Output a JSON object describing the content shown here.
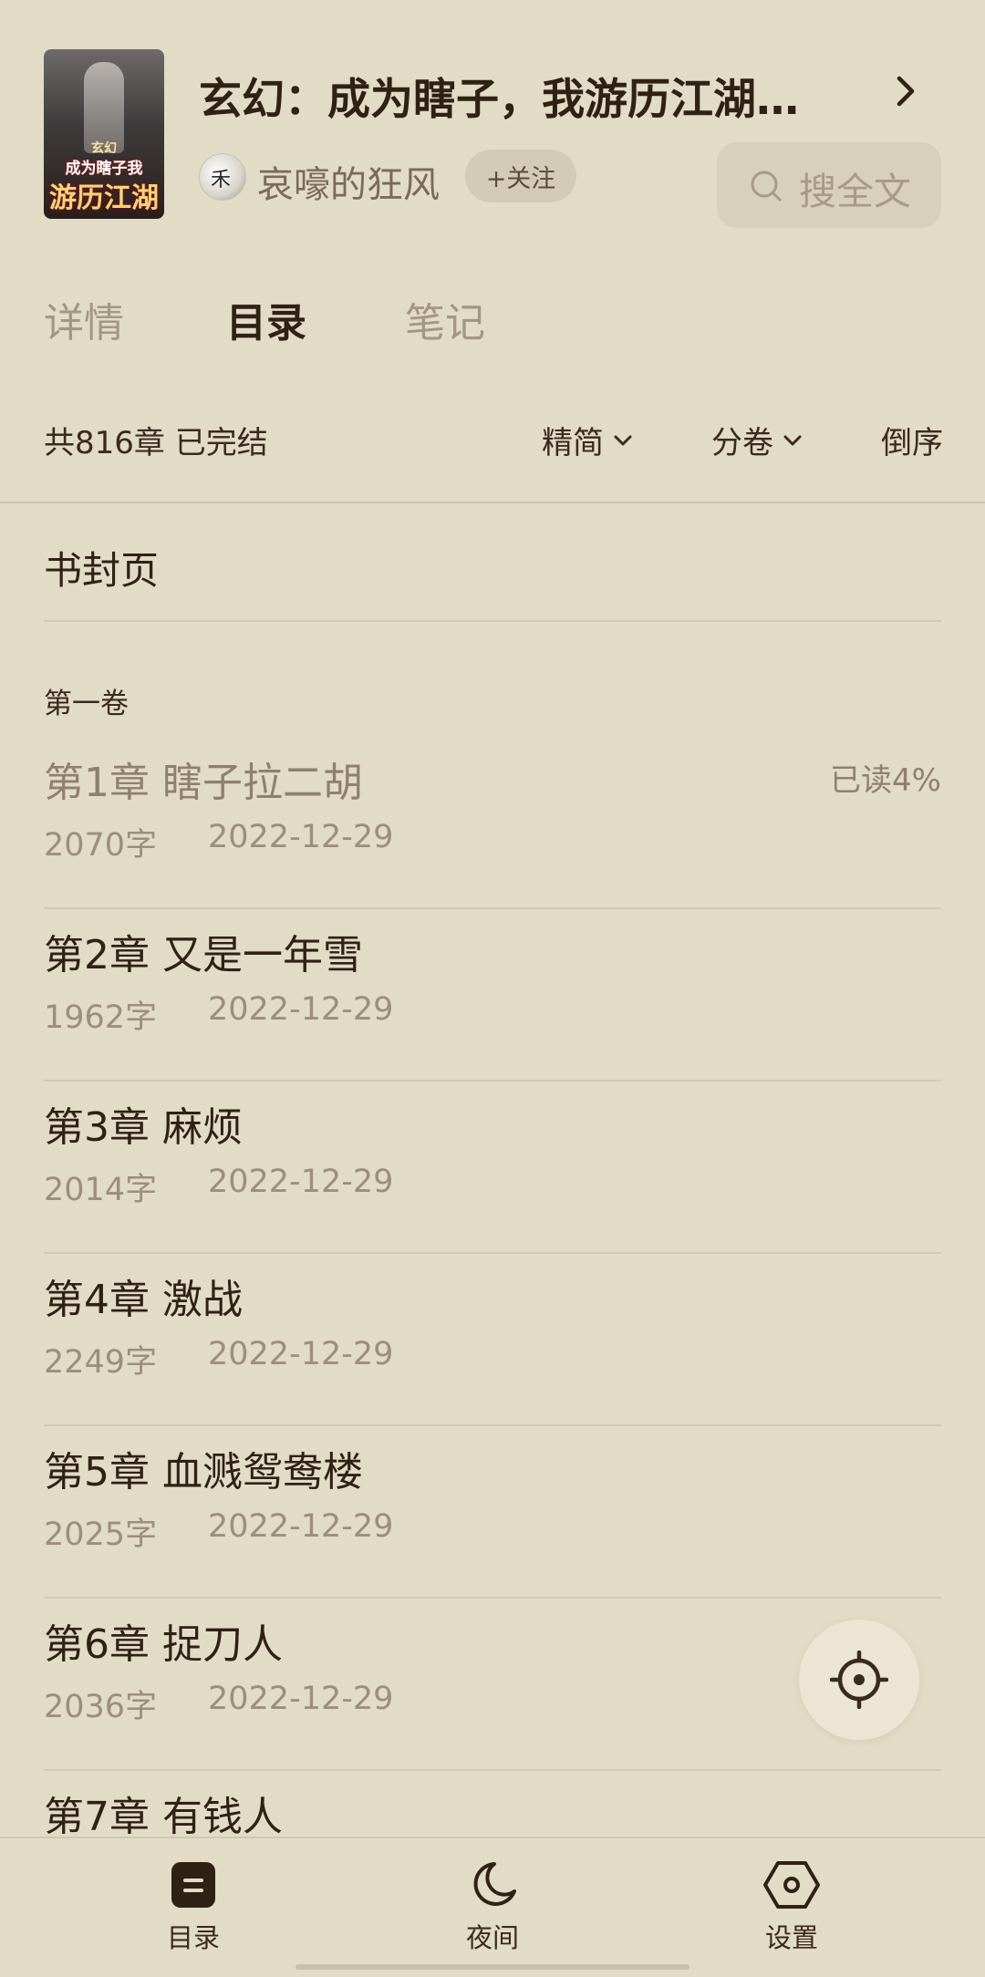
{
  "book": {
    "title": "玄幻：成为瞎子，我游历江湖…",
    "author": "哀嚎的狂风",
    "follow_label": "+关注",
    "cover": {
      "small": "玄幻",
      "mid": "成为瞎子我",
      "big": "游历江湖"
    }
  },
  "search": {
    "placeholder": "搜全文"
  },
  "tabs": [
    {
      "label": "详情",
      "active": false
    },
    {
      "label": "目录",
      "active": true
    },
    {
      "label": "笔记",
      "active": false
    }
  ],
  "toolbar": {
    "summary": "共816章 已完结",
    "simplified": "精简",
    "volume_split": "分卷",
    "reverse": "倒序"
  },
  "cover_page": "书封页",
  "volume_title": "第一卷",
  "chapters": [
    {
      "title": "第1章 瞎子拉二胡",
      "words": "2070字",
      "date": "2022-12-29",
      "progress": "已读4%"
    },
    {
      "title": "第2章 又是一年雪",
      "words": "1962字",
      "date": "2022-12-29"
    },
    {
      "title": "第3章 麻烦",
      "words": "2014字",
      "date": "2022-12-29"
    },
    {
      "title": "第4章 激战",
      "words": "2249字",
      "date": "2022-12-29"
    },
    {
      "title": "第5章 血溅鸳鸯楼",
      "words": "2025字",
      "date": "2022-12-29"
    },
    {
      "title": "第6章 捉刀人",
      "words": "2036字",
      "date": "2022-12-29"
    },
    {
      "title": "第7章 有钱人",
      "words": "",
      "date": ""
    }
  ],
  "bottom_nav": [
    {
      "label": "目录",
      "icon": "catalog-icon"
    },
    {
      "label": "夜间",
      "icon": "moon-icon"
    },
    {
      "label": "设置",
      "icon": "settings-hexagon-icon"
    }
  ],
  "colors": {
    "background": "#e2dbc6",
    "text": "#2f2114",
    "muted": "#9c8e7c"
  }
}
